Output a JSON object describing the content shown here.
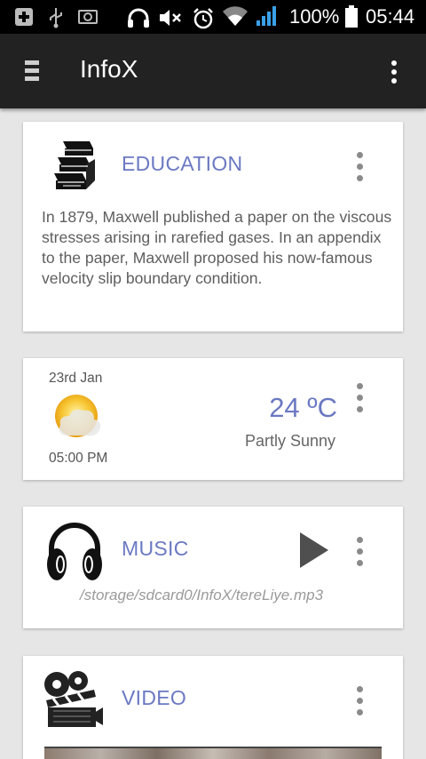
{
  "status_bar": {
    "battery_percent": "100%",
    "time": "05:44"
  },
  "app_bar": {
    "title": "InfoX"
  },
  "cards": {
    "education": {
      "title": "EDUCATION",
      "body": "In 1879, Maxwell published a paper on the viscous stresses arising in rarefied gases. In an appendix to the paper, Maxwell proposed his now-famous velocity slip boundary condition."
    },
    "weather": {
      "date": "23rd Jan",
      "time": "05:00 PM",
      "temperature": "24 ºC",
      "condition": "Partly Sunny"
    },
    "music": {
      "title": "MUSIC",
      "path": "/storage/sdcard0/InfoX/tereLiye.mp3"
    },
    "video": {
      "title": "VIDEO"
    }
  },
  "colors": {
    "accent": "#6b79c2",
    "app_bar": "#222222",
    "background": "#e6e6e6"
  },
  "icons": {
    "status_bar": [
      "add-notification-icon",
      "usb-icon",
      "screenshot-icon",
      "headphones-icon",
      "mute-icon",
      "alarm-icon",
      "wifi-icon",
      "signal-icon",
      "battery-icon"
    ],
    "education": "books-icon",
    "weather": "partly-sunny-icon",
    "music": "headphones-icon",
    "video": "film-clapper-icon"
  }
}
